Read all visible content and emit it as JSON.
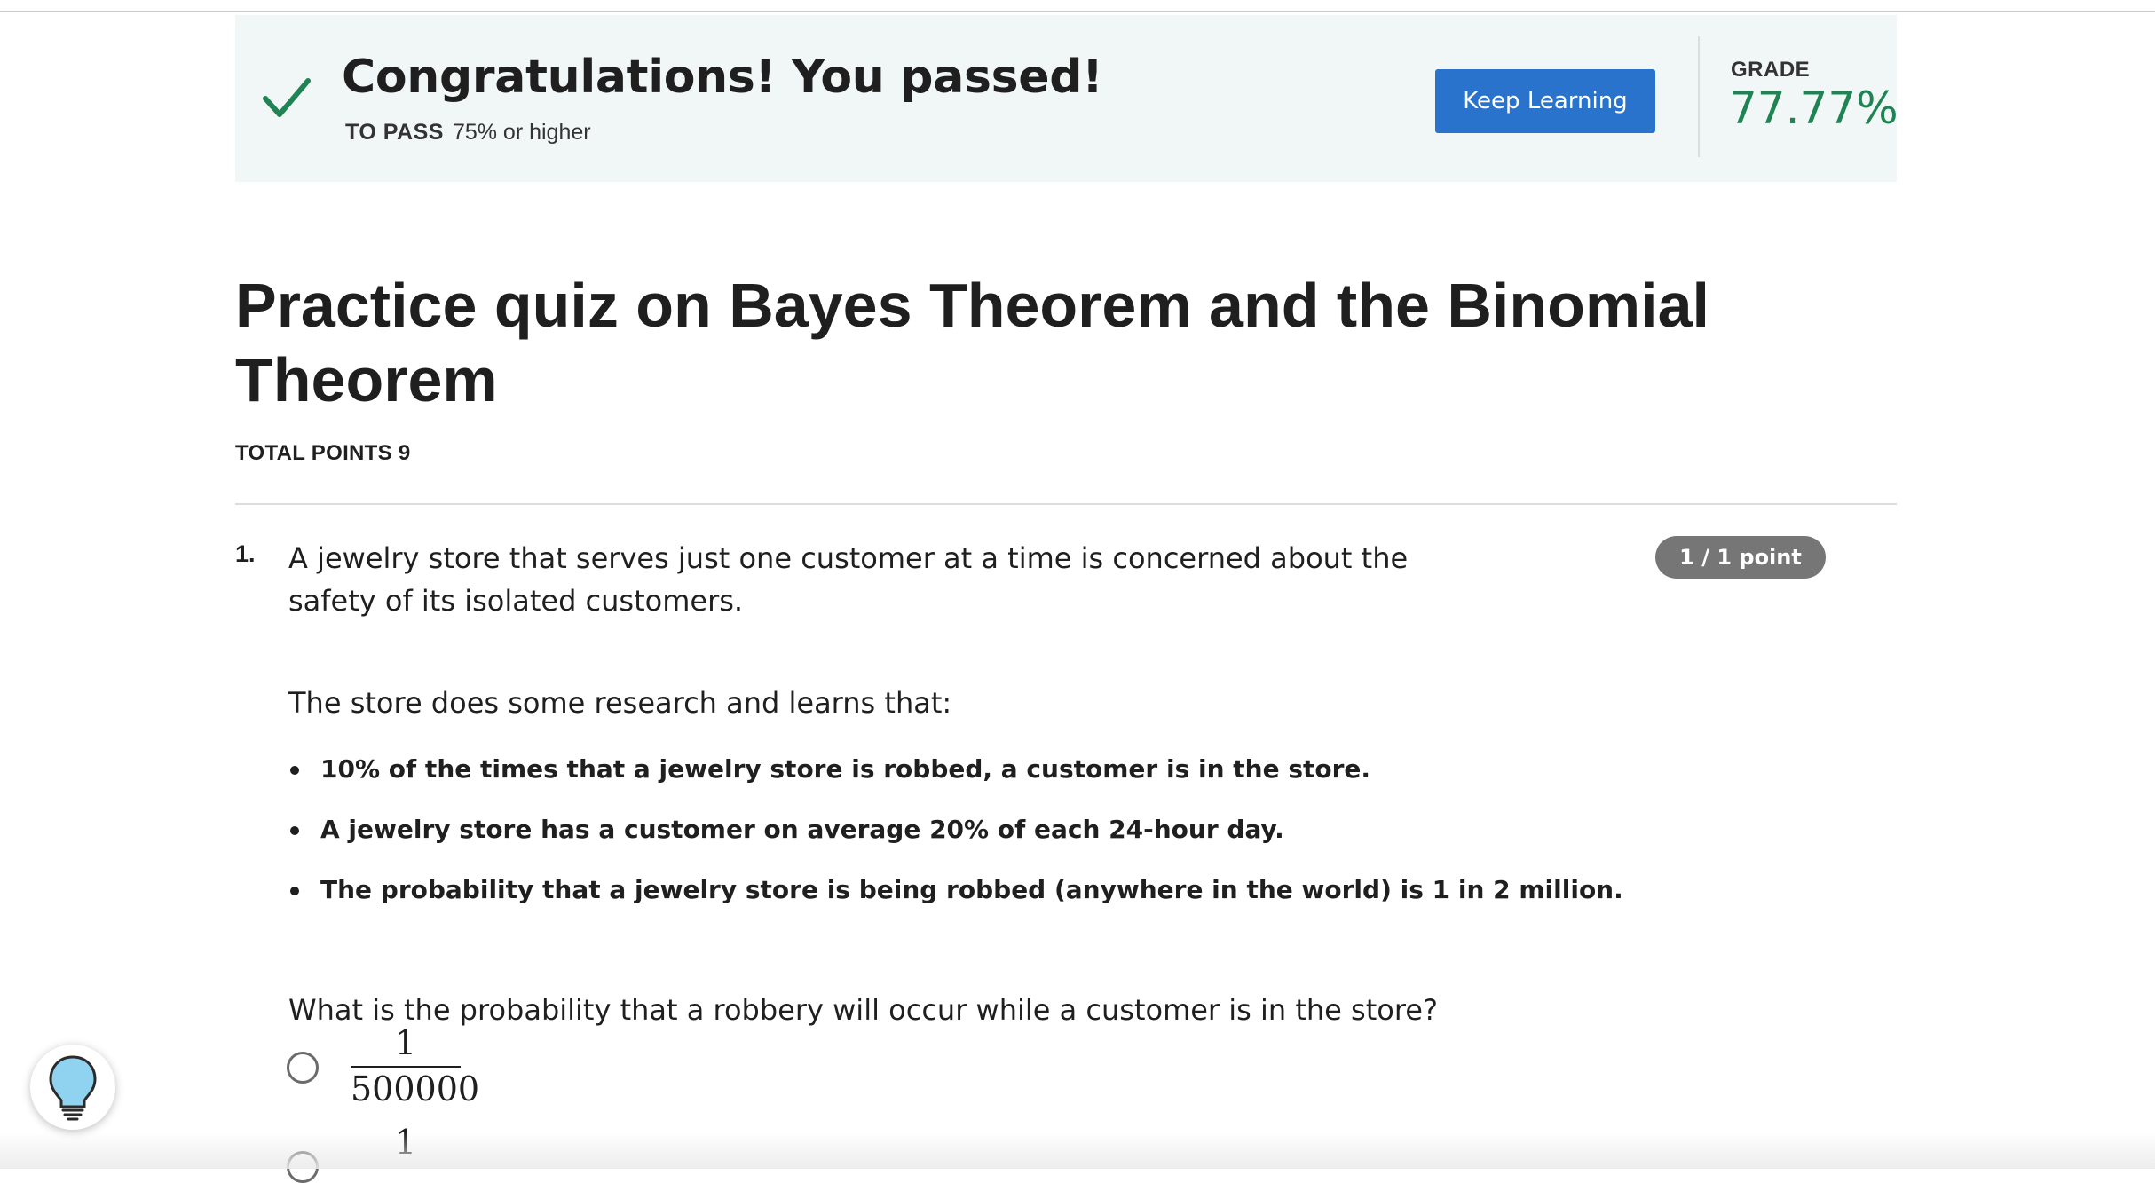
{
  "banner": {
    "title": "Congratulations! You passed!",
    "to_pass_label": "TO PASS",
    "to_pass_value": "75% or higher",
    "keep_learning_label": "Keep Learning",
    "grade_label": "GRADE",
    "grade_value": "77.77%",
    "accent_color": "#1f8354",
    "button_color": "#2a73cc"
  },
  "quiz": {
    "title": "Practice quiz on Bayes Theorem and the Binomial Theorem",
    "total_points": "TOTAL POINTS 9"
  },
  "question1": {
    "number": "1.",
    "text": "A jewelry store that serves just one customer at a time is concerned about the safety of its isolated customers.",
    "points": "1 / 1 point",
    "intro": "The store does some research and learns that:",
    "facts": [
      "10% of the times that a jewelry store is robbed, a customer is in the store.",
      "A jewelry store has a customer on average 20% of each 24-hour day.",
      "The probability that a jewelry store is being robbed (anywhere in the world) is 1 in 2 million."
    ],
    "prompt": "What is the probability that a robbery will occur while a customer is in the store?",
    "options": [
      {
        "numerator": "1",
        "denominator": "500000"
      },
      {
        "numerator": "1",
        "denominator": ""
      }
    ]
  },
  "help": {
    "icon": "lightbulb-icon"
  }
}
